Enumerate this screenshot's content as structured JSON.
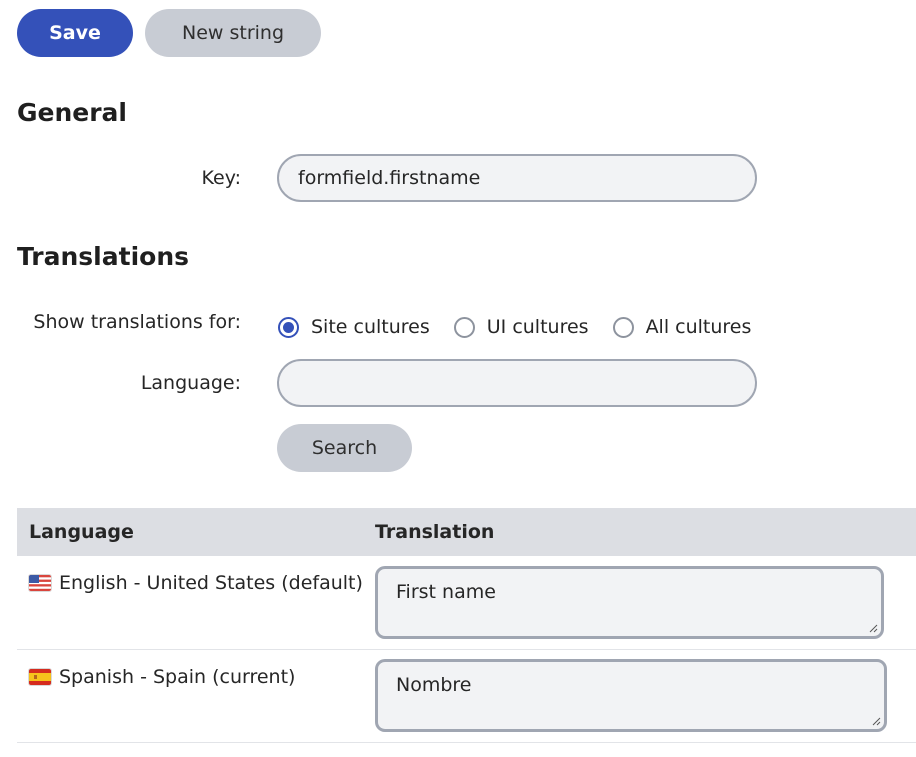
{
  "toolbar": {
    "save_label": "Save",
    "new_string_label": "New string"
  },
  "general": {
    "heading": "General",
    "key_label": "Key:",
    "key_value": "formfield.firstname"
  },
  "translations": {
    "heading": "Translations",
    "show_for_label": "Show translations for:",
    "options": [
      {
        "label": "Site cultures",
        "checked": true
      },
      {
        "label": "UI cultures",
        "checked": false
      },
      {
        "label": "All cultures",
        "checked": false
      }
    ],
    "language_label": "Language:",
    "language_value": "",
    "search_label": "Search"
  },
  "grid": {
    "columns": [
      "Language",
      "Translation"
    ],
    "rows": [
      {
        "language": "English - United States (default)",
        "flag": "us-flag-icon",
        "translation": "First name"
      },
      {
        "language": "Spanish - Spain (current)",
        "flag": "es-flag-icon",
        "translation": "Nombre"
      }
    ]
  },
  "colors": {
    "primary": "#3451b9",
    "secondary_button": "#c8ccd4",
    "header_bg": "#dcdee3",
    "input_bg": "#f2f3f5"
  }
}
